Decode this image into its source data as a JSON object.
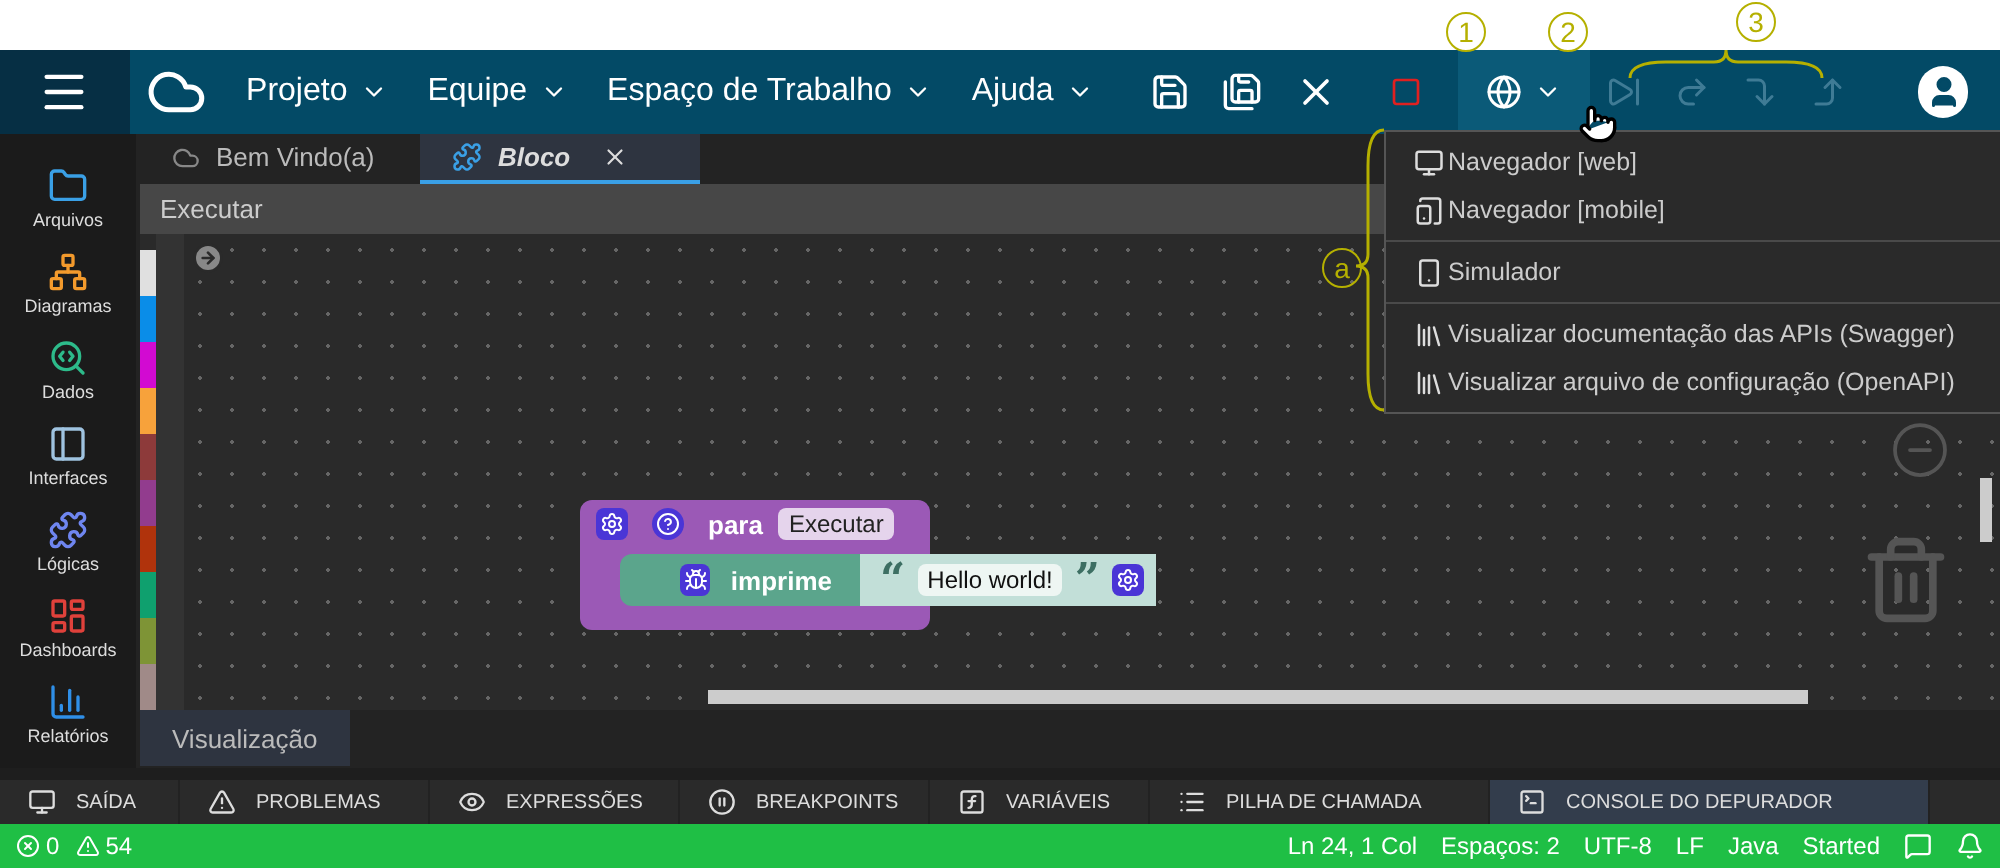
{
  "header": {
    "menus": [
      {
        "label": "Projeto"
      },
      {
        "label": "Equipe"
      },
      {
        "label": "Espaço de Trabalho"
      },
      {
        "label": "Ajuda"
      }
    ],
    "stop": {
      "disabled": false
    },
    "run_menu": {
      "expanded": true
    },
    "debug_tools": [
      {
        "kind": "step-end",
        "disabled": true
      },
      {
        "kind": "step-over",
        "disabled": true
      },
      {
        "kind": "step-into",
        "disabled": true
      },
      {
        "kind": "step-out",
        "disabled": true
      }
    ]
  },
  "annotations": [
    {
      "label": "1"
    },
    {
      "label": "2"
    },
    {
      "label": "3"
    },
    {
      "label": "a"
    }
  ],
  "sidebar": {
    "items": [
      {
        "label": "Arquivos",
        "kind": "files",
        "color": "#3aa0e6"
      },
      {
        "label": "Diagramas",
        "kind": "diagram",
        "color": "#f39a2c"
      },
      {
        "label": "Dados",
        "kind": "data",
        "color": "#2dbb8a"
      },
      {
        "label": "Interfaces",
        "kind": "interface",
        "color": "#9fc3e0"
      },
      {
        "label": "Lógicas",
        "kind": "logic",
        "color": "#6f86f0"
      },
      {
        "label": "Dashboards",
        "kind": "dashboard",
        "color": "#e0413b"
      },
      {
        "label": "Relatórios",
        "kind": "report",
        "color": "#2f8fe8"
      }
    ]
  },
  "tabs": [
    {
      "label": "Bem Vindo(a)",
      "selected": false,
      "closable": false
    },
    {
      "label": "Bloco",
      "selected": true,
      "closable": true
    }
  ],
  "toolbar": {
    "label": "Executar"
  },
  "toolbox_categories": [
    {
      "color": "#e0e0e0"
    },
    {
      "color": "#0a8de8"
    },
    {
      "color": "#d20ad2"
    },
    {
      "color": "#f7a23b"
    },
    {
      "color": "#8d3a3a"
    },
    {
      "color": "#923c8e"
    },
    {
      "color": "#b0330c"
    },
    {
      "color": "#0fa06e"
    },
    {
      "color": "#7e9436"
    },
    {
      "color": "#a08a88"
    }
  ],
  "blocks": {
    "function": {
      "keyword": "para",
      "name": "Executar"
    },
    "statement": {
      "keyword": "imprime",
      "open_quote": "“",
      "text": "Hello world!",
      "close_quote": "”"
    }
  },
  "menu": {
    "groups": [
      [
        {
          "label": "Navegador [web]",
          "kind": "monitor"
        },
        {
          "label": "Navegador [mobile]",
          "kind": "devices"
        }
      ],
      [
        {
          "label": "Simulador",
          "kind": "phone"
        }
      ],
      [
        {
          "label": "Visualizar documentação das APIs (Swagger)",
          "kind": "books"
        },
        {
          "label": "Visualizar arquivo de configuração (OpenAPI)",
          "kind": "books"
        }
      ]
    ]
  },
  "view_tab": {
    "label": "Visualização"
  },
  "panel_tabs": [
    {
      "label": "SAÍDA",
      "kind": "output",
      "selected": false
    },
    {
      "label": "PROBLEMAS",
      "kind": "problems",
      "selected": false
    },
    {
      "label": "EXPRESSÕES",
      "kind": "watch",
      "selected": false
    },
    {
      "label": "BREAKPOINTS",
      "kind": "breakpoints",
      "selected": false
    },
    {
      "label": "VARIÁVEIS",
      "kind": "variables",
      "selected": false
    },
    {
      "label": "PILHA DE CHAMADA",
      "kind": "stack",
      "selected": false
    },
    {
      "label": "CONSOLE DO DEPURADOR",
      "kind": "console",
      "selected": true
    }
  ],
  "status_bar": {
    "errors": "0",
    "warnings": "54",
    "items": [
      "Ln 24, 1 Col",
      "Espaços: 2",
      "UTF-8",
      "LF",
      "Java"
    ],
    "runtime": "Started"
  }
}
